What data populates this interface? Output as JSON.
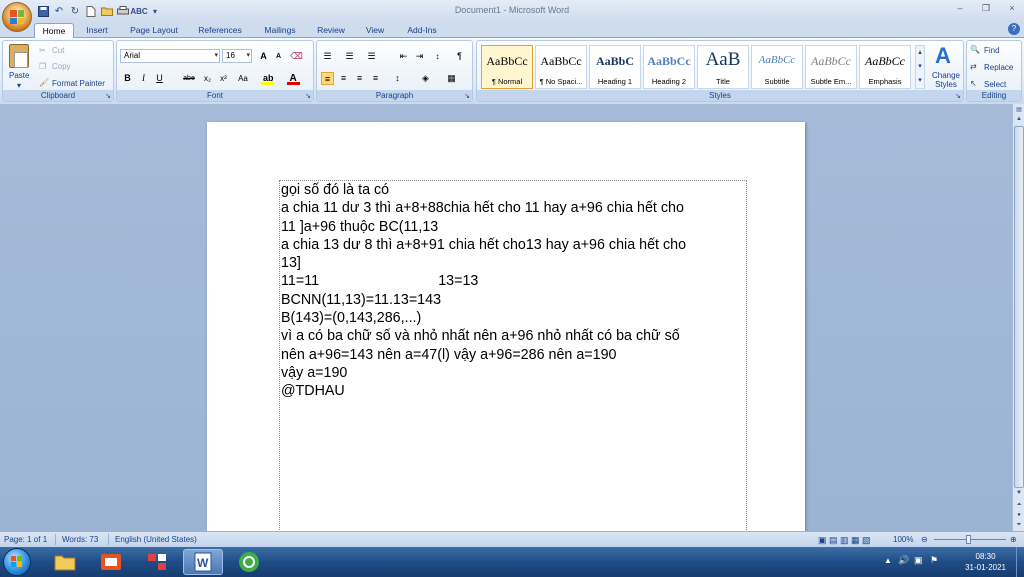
{
  "window": {
    "title": "Document1 - Microsoft Word",
    "minimize_glyph": "–",
    "restore_glyph": "❐",
    "close_glyph": "×"
  },
  "qat_icons": [
    "save-icon",
    "undo-icon",
    "redo-icon",
    "new-icon",
    "open-icon",
    "print-preview-icon",
    "spelling-icon",
    "customize-icon"
  ],
  "tabs": [
    {
      "label": "Home",
      "active": true
    },
    {
      "label": "Insert"
    },
    {
      "label": "Page Layout"
    },
    {
      "label": "References"
    },
    {
      "label": "Mailings"
    },
    {
      "label": "Review"
    },
    {
      "label": "View"
    },
    {
      "label": "Add-Ins"
    }
  ],
  "ribbon": {
    "clipboard": {
      "label": "Clipboard",
      "paste": "Paste",
      "cut": "Cut",
      "copy": "Copy",
      "format_painter": "Format Painter"
    },
    "font": {
      "label": "Font",
      "family": "Arial",
      "size": "16",
      "bold": "B",
      "italic": "I",
      "underline": "U",
      "strike": "abe",
      "subscript": "x₂",
      "superscript": "x²",
      "change_case": "Aa",
      "grow": "A",
      "shrink": "A"
    },
    "paragraph": {
      "label": "Paragraph"
    },
    "styles": {
      "label": "Styles",
      "items": [
        {
          "preview": "AaBbCc",
          "label": "¶ Normal",
          "selected": true
        },
        {
          "preview": "AaBbCc",
          "label": "¶ No Spaci..."
        },
        {
          "preview": "AaBbC",
          "label": "Heading 1"
        },
        {
          "preview": "AaBbCc",
          "label": "Heading 2"
        },
        {
          "preview": "AaB",
          "label": "Title"
        },
        {
          "preview": "AaBbCc",
          "label": "Subtitle"
        },
        {
          "preview": "AaBbCc",
          "label": "Subtle Em..."
        },
        {
          "preview": "AaBbCc",
          "label": "Emphasis"
        }
      ],
      "change_styles": "Change Styles"
    },
    "editing": {
      "label": "Editing",
      "find": "Find",
      "replace": "Replace",
      "select": "Select"
    }
  },
  "document": {
    "lines": [
      "gọi số đó là ta có",
      "a chia 11 dư 3 thì a+8+88chia hết cho 11 hay a+96 chia hết cho",
      "11 ]a+96 thuộc BC(11,13",
      "a chia 13 dư 8 thì a+8+91 chia hết cho13 hay a+96 chia hết cho",
      "13]",
      "11=11                              13=13",
      "BCNN(11,13)=11.13=143",
      "B(143)=(0,143,286,...)",
      "vì a có ba chữ số và nhỏ nhất nên a+96 nhỏ nhất có ba chữ số",
      "nên a+96=143 nên a=47(l) vậy a+96=286 nên a=190",
      "vậy a=190",
      "@TDHAU"
    ]
  },
  "status": {
    "page": "Page: 1 of 1",
    "words": "Words: 73",
    "language": "English (United States)",
    "zoom": "100%"
  },
  "taskbar": {
    "time": "08:30",
    "date": "31-01-2021"
  },
  "colors": {
    "ribbon_text": "#15428b",
    "doc_background": "#9fb5d2",
    "taskbar": "#1f4c86"
  }
}
